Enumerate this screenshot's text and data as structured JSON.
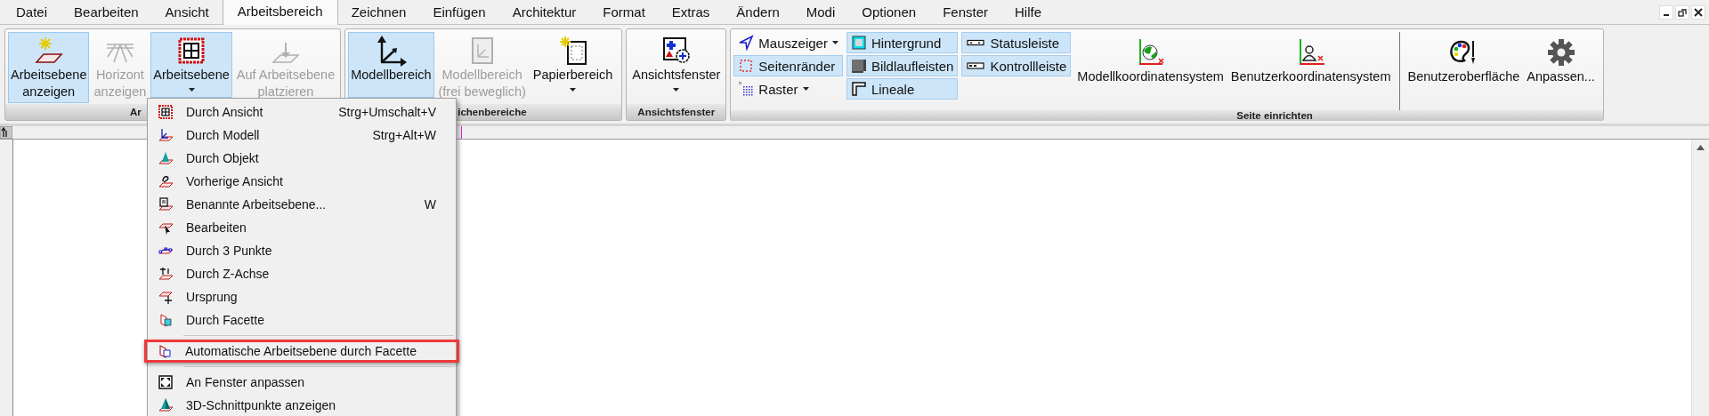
{
  "tabs": [
    {
      "label": "Datei",
      "selected": false
    },
    {
      "label": "Bearbeiten",
      "selected": false
    },
    {
      "label": "Ansicht",
      "selected": false
    },
    {
      "label": "Arbeitsbereich",
      "selected": true
    },
    {
      "label": "Zeichnen",
      "selected": false
    },
    {
      "label": "Einfügen",
      "selected": false
    },
    {
      "label": "Architektur",
      "selected": false
    },
    {
      "label": "Format",
      "selected": false
    },
    {
      "label": "Extras",
      "selected": false
    },
    {
      "label": "Ändern",
      "selected": false
    },
    {
      "label": "Modi",
      "selected": false
    },
    {
      "label": "Optionen",
      "selected": false
    },
    {
      "label": "Fenster",
      "selected": false
    },
    {
      "label": "Hilfe",
      "selected": false
    }
  ],
  "ribbon": {
    "groups": [
      {
        "label": "Ar",
        "items": [
          {
            "kind": "large",
            "lines": [
              "Arbeitsebene",
              "anzeigen"
            ],
            "selected": true,
            "disabled": false,
            "dropdown": false
          },
          {
            "kind": "large",
            "lines": [
              "Horizont",
              "anzeigen"
            ],
            "selected": false,
            "disabled": true,
            "dropdown": false
          },
          {
            "kind": "large",
            "lines": [
              "Arbeitsebene"
            ],
            "selected": true,
            "disabled": false,
            "dropdown": true
          },
          {
            "kind": "large",
            "lines": [
              "Auf Arbeitsebene",
              "platzieren"
            ],
            "selected": false,
            "disabled": true,
            "dropdown": false
          }
        ]
      },
      {
        "label": "ichenbereiche",
        "items": [
          {
            "kind": "large",
            "lines": [
              "Modellbereich"
            ],
            "selected": true,
            "disabled": false,
            "dropdown": false
          },
          {
            "kind": "large",
            "lines": [
              "Modellbereich",
              "(frei beweglich)"
            ],
            "selected": false,
            "disabled": true,
            "dropdown": false
          },
          {
            "kind": "large",
            "lines": [
              "Papierbereich"
            ],
            "selected": false,
            "disabled": false,
            "dropdown": true
          }
        ]
      },
      {
        "label": "Ansichtsfenster",
        "items": [
          {
            "kind": "large",
            "lines": [
              "Ansichtsfenster"
            ],
            "selected": false,
            "disabled": false,
            "dropdown": true
          }
        ]
      },
      {
        "label": "Seite einrichten",
        "items": [
          {
            "kind": "stack",
            "items": [
              {
                "label": "Mauszeiger",
                "selected": false,
                "dropdown": true
              },
              {
                "label": "Seitenränder",
                "selected": true,
                "dropdown": false
              },
              {
                "label": "Raster",
                "selected": false,
                "dropdown": true
              }
            ]
          },
          {
            "kind": "stack",
            "items": [
              {
                "label": "Hintergrund",
                "selected": true,
                "dropdown": false
              },
              {
                "label": "Bildlaufleisten",
                "selected": true,
                "dropdown": false
              },
              {
                "label": "Lineale",
                "selected": true,
                "dropdown": false
              }
            ]
          },
          {
            "kind": "stack",
            "items": [
              {
                "label": "Statusleiste",
                "selected": true,
                "dropdown": false
              },
              {
                "label": "Kontrollleiste",
                "selected": true,
                "dropdown": false
              }
            ]
          },
          {
            "kind": "wide",
            "lines": [
              "Modellkoordinatensystem"
            ],
            "selected": false,
            "disabled": false,
            "dropdown": false
          },
          {
            "kind": "wide",
            "lines": [
              "Benutzerkoordinatensystem"
            ],
            "selected": false,
            "disabled": false,
            "dropdown": false
          },
          {
            "kind": "separator"
          },
          {
            "kind": "wide",
            "lines": [
              "Benutzeroberfläche"
            ],
            "selected": false,
            "disabled": false,
            "dropdown": false
          },
          {
            "kind": "wide",
            "lines": [
              "Anpassen..."
            ],
            "selected": false,
            "disabled": false,
            "dropdown": false
          }
        ]
      }
    ]
  },
  "menu": {
    "items": [
      {
        "kind": "item",
        "label": "Durch Ansicht",
        "shortcut": "Strg+Umschalt+V",
        "highlighted": false
      },
      {
        "kind": "item",
        "label": "Durch Modell",
        "shortcut": "Strg+Alt+W",
        "highlighted": false
      },
      {
        "kind": "item",
        "label": "Durch Objekt",
        "highlighted": false
      },
      {
        "kind": "item",
        "label": "Vorherige Ansicht",
        "highlighted": false
      },
      {
        "kind": "item",
        "label": "Benannte Arbeitsebene...",
        "shortcut": "W",
        "highlighted": false
      },
      {
        "kind": "item",
        "label": "Bearbeiten",
        "highlighted": false
      },
      {
        "kind": "item",
        "label": "Durch 3 Punkte",
        "highlighted": false
      },
      {
        "kind": "item",
        "label": "Durch Z-Achse",
        "highlighted": false
      },
      {
        "kind": "item",
        "label": "Ursprung",
        "highlighted": false
      },
      {
        "kind": "item",
        "label": "Durch Facette",
        "highlighted": false
      },
      {
        "kind": "separator"
      },
      {
        "kind": "item",
        "label": "Automatische Arbeitsebene durch Facette",
        "highlighted": true
      },
      {
        "kind": "separator"
      },
      {
        "kind": "item",
        "label": "An Fenster anpassen",
        "highlighted": false
      },
      {
        "kind": "item",
        "label": "3D-Schnittpunkte anzeigen",
        "highlighted": false
      }
    ]
  }
}
